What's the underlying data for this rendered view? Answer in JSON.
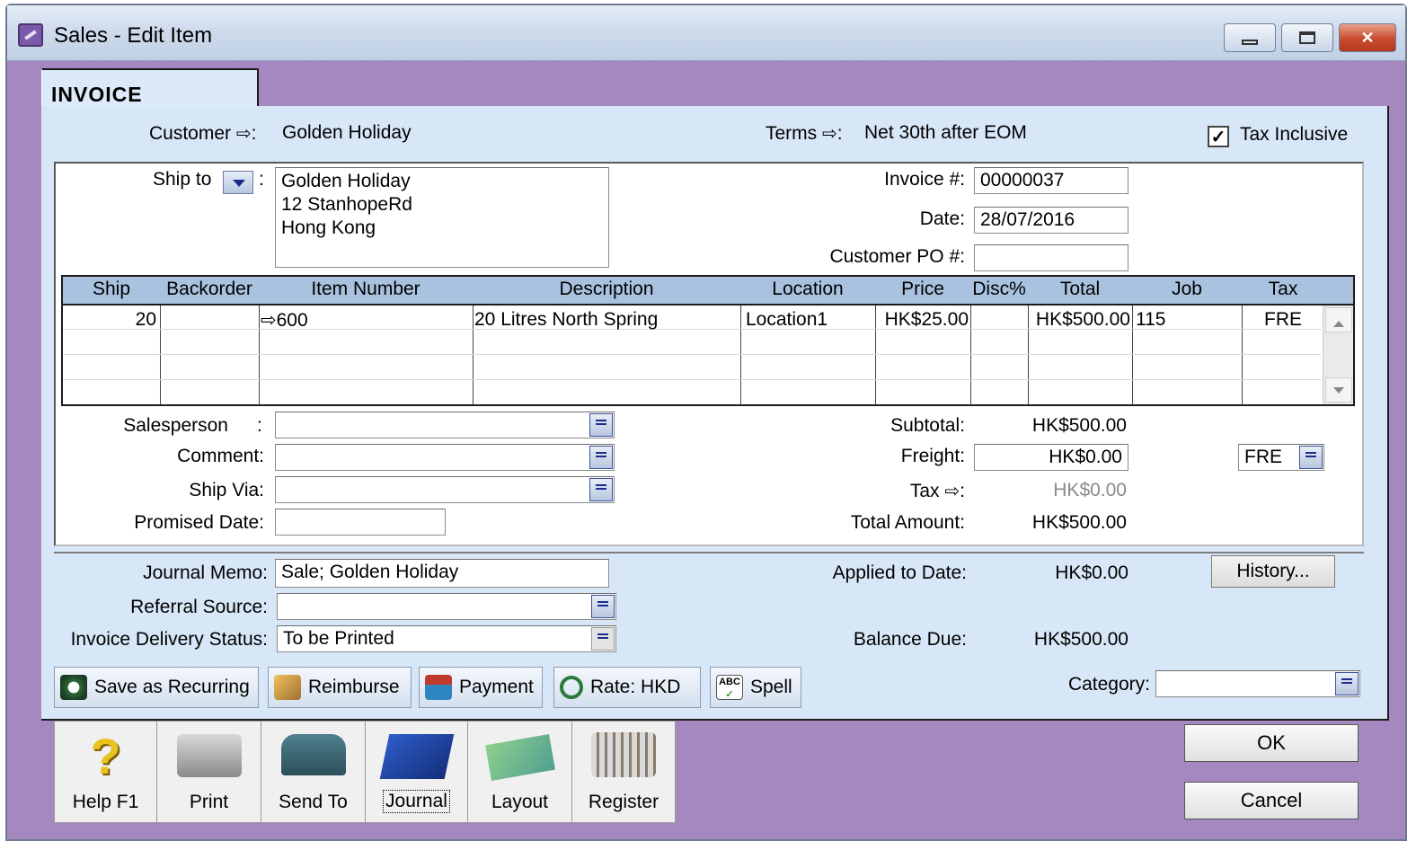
{
  "window": {
    "title": "Sales - Edit Item"
  },
  "tab": {
    "label": "INVOICE"
  },
  "header": {
    "customer_label": "Customer",
    "customer_value": "Golden Holiday",
    "terms_label": "Terms",
    "terms_value": "Net 30th after EOM",
    "tax_inclusive_label": "Tax Inclusive",
    "tax_inclusive_checked": true
  },
  "shipping": {
    "ship_to_label": "Ship to",
    "address_lines": [
      "Golden Holiday",
      "12 StanhopeRd",
      "Hong Kong"
    ]
  },
  "invoice_meta": {
    "invoice_no_label": "Invoice #:",
    "invoice_no": "00000037",
    "date_label": "Date:",
    "date": "28/07/2016",
    "customer_po_label": "Customer PO #:",
    "customer_po": ""
  },
  "lines": {
    "columns": [
      "Ship",
      "Backorder",
      "Item Number",
      "Description",
      "Location",
      "Price",
      "Disc%",
      "Total",
      "Job",
      "Tax"
    ],
    "rows": [
      {
        "ship": "20",
        "backorder": "",
        "item_number": "600",
        "description": "20 Litres North Spring",
        "location": "Location1",
        "price": "HK$25.00",
        "disc": "",
        "total": "HK$500.00",
        "job": "115",
        "tax": "FRE"
      }
    ]
  },
  "details": {
    "salesperson_label": "Salesperson",
    "comment_label": "Comment:",
    "ship_via_label": "Ship Via:",
    "promised_date_label": "Promised Date:"
  },
  "totals": {
    "subtotal_label": "Subtotal:",
    "subtotal": "HK$500.00",
    "freight_label": "Freight:",
    "freight": "HK$0.00",
    "freight_tax_code": "FRE",
    "tax_label": "Tax",
    "tax": "HK$0.00",
    "total_label": "Total Amount:",
    "total": "HK$500.00"
  },
  "journal": {
    "memo_label": "Journal Memo:",
    "memo": "Sale; Golden Holiday",
    "referral_label": "Referral Source:",
    "delivery_label": "Invoice Delivery Status:",
    "delivery_value": "To be Printed",
    "applied_label": "Applied to Date:",
    "applied": "HK$0.00",
    "balance_label": "Balance Due:",
    "balance": "HK$500.00",
    "history_label": "History..."
  },
  "toolbar": {
    "save_recurring": "Save as Recurring",
    "reimburse": "Reimburse",
    "payment": "Payment",
    "rate": "Rate:  HKD",
    "spell": "Spell",
    "category_label": "Category:"
  },
  "bottom": {
    "help": "Help F1",
    "print": "Print",
    "send_to": "Send To",
    "journal": "Journal",
    "layout": "Layout",
    "register": "Register",
    "ok": "OK",
    "cancel": "Cancel"
  }
}
